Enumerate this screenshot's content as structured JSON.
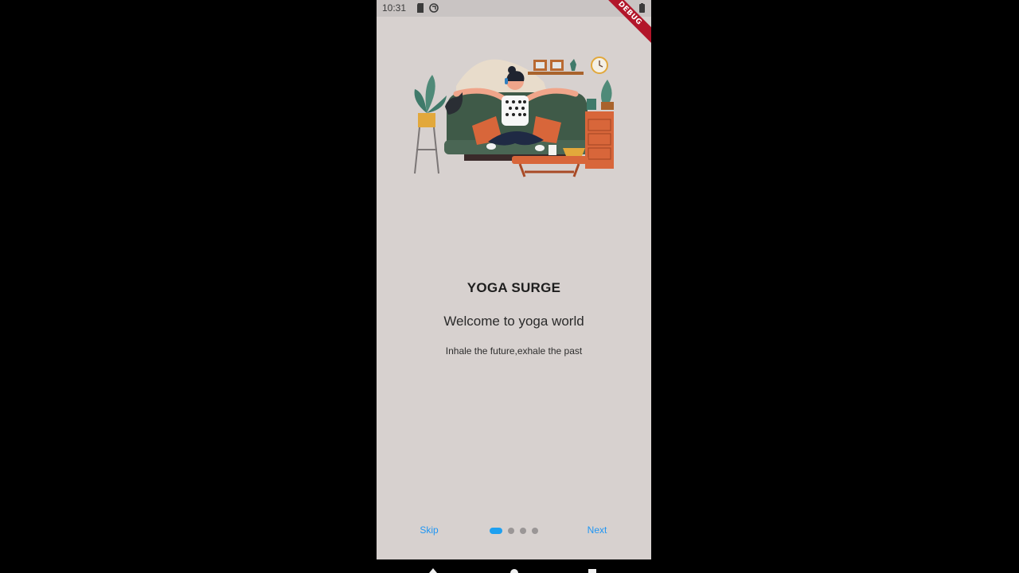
{
  "status_bar": {
    "time": "10:31",
    "icons": [
      "sd-card-icon",
      "sync-icon",
      "battery-icon"
    ],
    "debug_banner": "DEBUG"
  },
  "onboarding": {
    "illustration": "woman-meditating-on-sofa-illustration",
    "title": "YOGA SURGE",
    "subtitle": "Welcome to yoga world",
    "tagline": "Inhale the future,exhale the past",
    "current_page": 1,
    "page_count": 4
  },
  "footer": {
    "skip_label": "Skip",
    "next_label": "Next"
  },
  "colors": {
    "background": "#d7d1cf",
    "accent": "#2196f3",
    "active_dot": "#1ea0f0",
    "inactive_dot": "#9a9696",
    "debug_banner": "#b2162a"
  },
  "system_nav": {
    "icons": [
      "back-icon",
      "home-icon",
      "recents-icon"
    ]
  }
}
